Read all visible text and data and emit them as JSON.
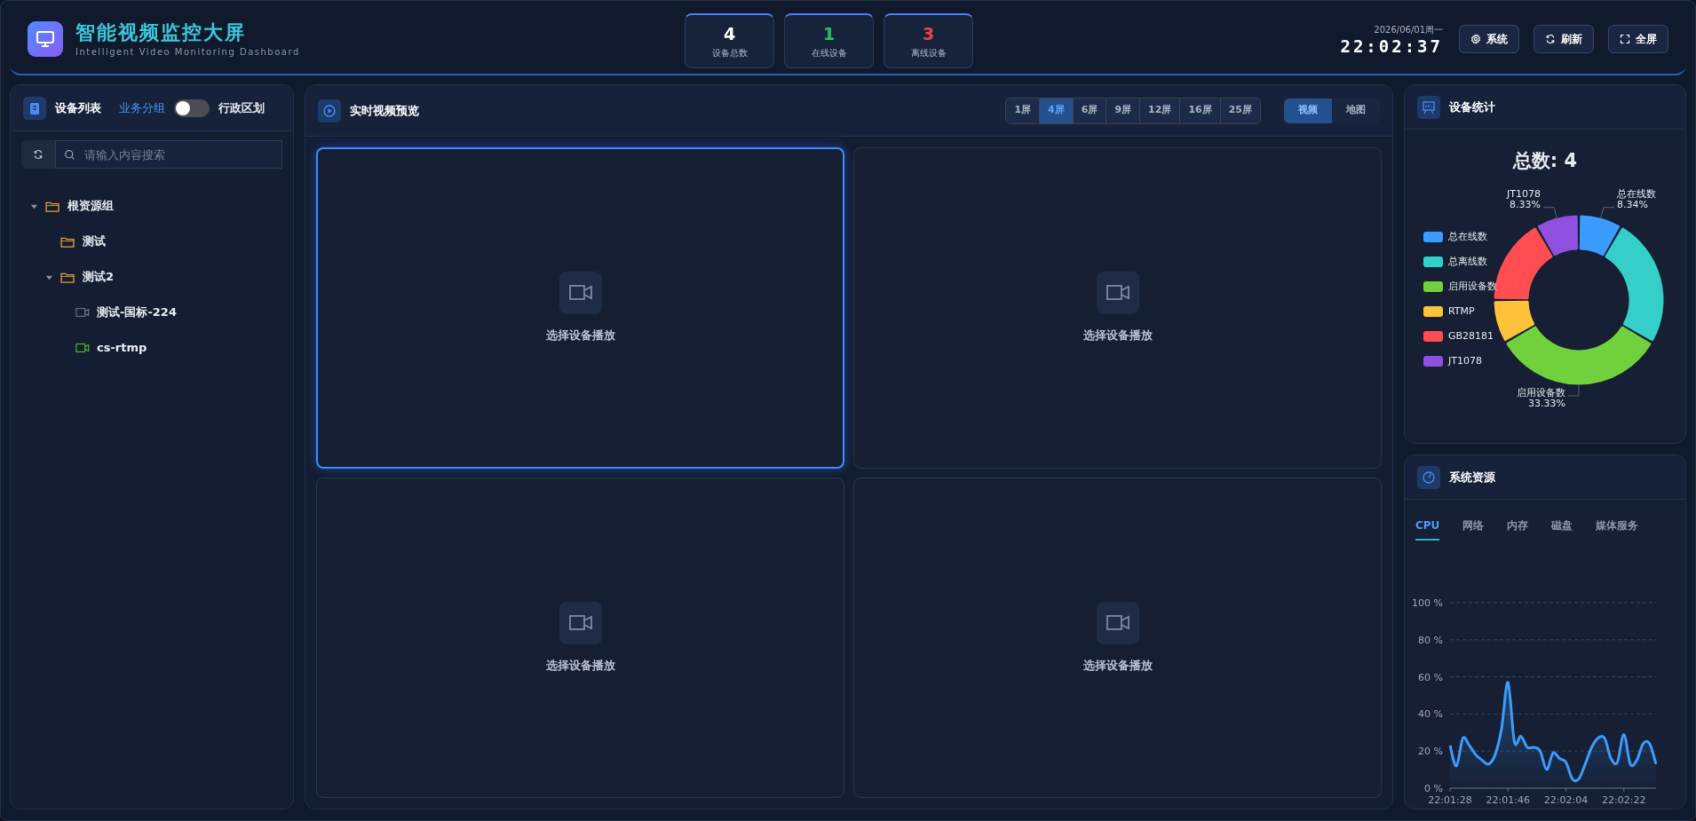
{
  "header": {
    "title": "智能视频监控大屏",
    "subtitle": "Intelligent Video Monitoring Dashboard",
    "stats": [
      {
        "value": "4",
        "label": "设备总数",
        "color": "#ffffff"
      },
      {
        "value": "1",
        "label": "在线设备",
        "color": "#22c55e"
      },
      {
        "value": "3",
        "label": "离线设备",
        "color": "#ef4444"
      }
    ],
    "date": "2026/06/01周一",
    "time": "22:02:37",
    "buttons": [
      {
        "kind": "gear",
        "label": "系统"
      },
      {
        "kind": "refresh",
        "label": "刷新"
      },
      {
        "kind": "fullscreen",
        "label": "全屏"
      }
    ]
  },
  "device_panel": {
    "title": "设备列表",
    "group_left": "业务分组",
    "group_right": "行政区划",
    "toggle_on": false,
    "search_placeholder": "请输入内容搜索",
    "tree": [
      {
        "kind": "folder",
        "label": "根资源组",
        "expanded": true,
        "children": [
          {
            "kind": "folder",
            "label": "测试"
          },
          {
            "kind": "folder",
            "label": "测试2",
            "expanded": true,
            "children": [
              {
                "kind": "camera",
                "label": "测试-国标-224",
                "online": false
              },
              {
                "kind": "camera",
                "label": "cs-rtmp",
                "online": true
              }
            ]
          }
        ]
      }
    ]
  },
  "preview": {
    "title": "实时视频预览",
    "layouts": [
      {
        "label": "1屏",
        "selected": false
      },
      {
        "label": "4屏",
        "selected": true
      },
      {
        "label": "6屏",
        "selected": false
      },
      {
        "label": "9屏",
        "selected": false
      },
      {
        "label": "12屏",
        "selected": false
      },
      {
        "label": "16屏",
        "selected": false
      },
      {
        "label": "25屏",
        "selected": false
      }
    ],
    "modes": [
      {
        "label": "视频",
        "selected": true
      },
      {
        "label": "地图",
        "selected": false
      }
    ],
    "cells": [
      {
        "label": "选择设备播放",
        "selected": true
      },
      {
        "label": "选择设备播放",
        "selected": false
      },
      {
        "label": "选择设备播放",
        "selected": false
      },
      {
        "label": "选择设备播放",
        "selected": false
      }
    ]
  },
  "device_stats": {
    "title": "设备统计",
    "chart_data": {
      "type": "donut",
      "title": "总数: 4",
      "categories": [
        "总在线数",
        "总离线数",
        "启用设备数",
        "RTMP",
        "GB28181",
        "JT1078"
      ],
      "values": [
        8.34,
        25,
        33.33,
        8.33,
        16.67,
        8.33
      ],
      "legend": true,
      "colors": [
        "#3b9cff",
        "#34cfc9",
        "#71d13c",
        "#fec23a",
        "#ff4d51",
        "#8f50e0"
      ],
      "value_labels": [
        "8.34%",
        null,
        "33.33%",
        null,
        null,
        "8.33%"
      ]
    }
  },
  "system_resources": {
    "title": "系统资源",
    "tabs": [
      {
        "label": "CPU",
        "selected": true
      },
      {
        "label": "网络",
        "selected": false
      },
      {
        "label": "内存",
        "selected": false
      },
      {
        "label": "磁盘",
        "selected": false
      },
      {
        "label": "媒体服务",
        "selected": false
      }
    ],
    "chart_data": {
      "type": "area",
      "series": [
        {
          "color": "#3b9cff",
          "values": [
            23,
            12,
            27,
            23,
            18,
            15,
            13,
            18,
            32,
            57,
            25,
            28,
            22,
            22,
            20,
            10,
            19,
            16,
            14,
            5,
            5,
            13,
            22,
            27,
            27,
            16,
            14,
            29,
            13,
            15,
            24,
            24,
            13
          ]
        }
      ],
      "categories": [
        "22:01:28",
        null,
        null,
        null,
        null,
        null,
        null,
        null,
        null,
        "22:01:46",
        null,
        null,
        null,
        null,
        null,
        null,
        null,
        null,
        "22:02:04",
        null,
        null,
        null,
        null,
        null,
        null,
        null,
        null,
        "22:02:22",
        null,
        null,
        null,
        null,
        null
      ],
      "ylim": [
        0,
        100
      ],
      "grid": true,
      "yticks": [
        {
          "value": 0,
          "label": "0 %"
        },
        {
          "value": 20,
          "label": "20 %"
        },
        {
          "value": 40,
          "label": "40 %"
        },
        {
          "value": 60,
          "label": "60 %"
        },
        {
          "value": 80,
          "label": "80 %"
        },
        {
          "value": 100,
          "label": "100 %"
        }
      ]
    }
  }
}
